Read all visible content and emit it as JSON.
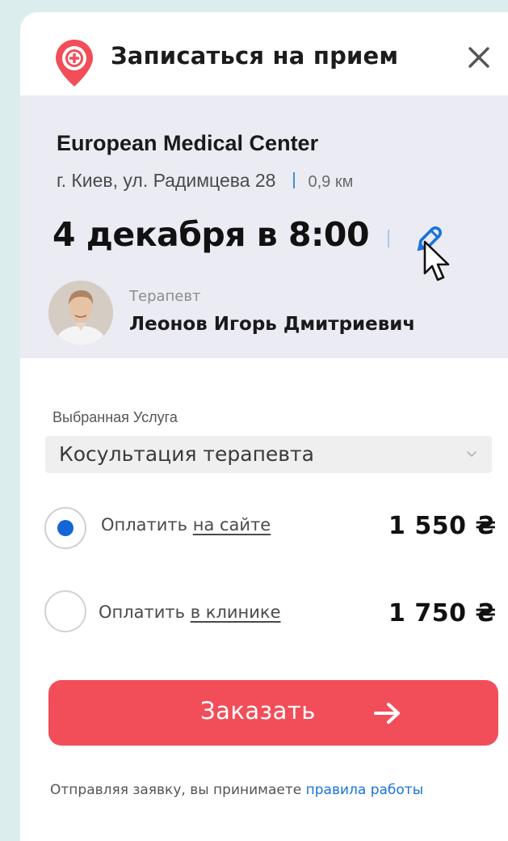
{
  "header": {
    "title": "Записаться на прием",
    "logo_icon": "map-pin-plus-icon",
    "close_icon": "close-icon",
    "accent": "#f24e59"
  },
  "clinic": {
    "name": "European Medical Center",
    "address": "г. Киев, ул. Радимцева 28",
    "distance": "0,9 км"
  },
  "appointment": {
    "datetime": "4 декабря в 8:00",
    "edit_icon": "pencil-icon"
  },
  "doctor": {
    "specialty": "Терапевт",
    "name": "Леонов Игорь Дмитриевич"
  },
  "service": {
    "label": "Выбранная Услуга",
    "selected": "Косультация терапевта"
  },
  "payment": {
    "options": [
      {
        "prefix": "Оплатить",
        "link": "на сайте",
        "price": "1 550 ₴",
        "selected": true
      },
      {
        "prefix": "Оплатить",
        "link": "в клинике",
        "price": "1 750 ₴",
        "selected": false
      }
    ],
    "selected_color": "#1565d8"
  },
  "order_button": {
    "label": "Заказать",
    "color": "#f24e59"
  },
  "footer": {
    "text": "Отправляя заявку, вы принимаете",
    "link": "правила работы",
    "link_color": "#1a73d9"
  }
}
